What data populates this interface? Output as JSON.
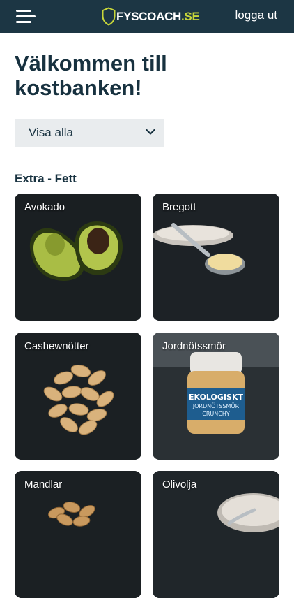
{
  "header": {
    "menu_icon": "hamburger-menu-icon",
    "logo_main": "FYSCOACH",
    "logo_tld": ".SE",
    "logout_label": "logga ut",
    "colors": {
      "bar": "#1c3644",
      "accent": "#c7d63a"
    }
  },
  "main": {
    "title": "Välkommen till kostbanken!",
    "filter": {
      "selected": "Visa alla",
      "icon": "chevron-down-icon"
    },
    "section_title": "Extra - Fett",
    "items": [
      {
        "label": "Avokado"
      },
      {
        "label": "Bregott"
      },
      {
        "label": "Cashewnötter"
      },
      {
        "label": "Jordnötssmör"
      },
      {
        "label": "Mandlar"
      },
      {
        "label": "Olivolja"
      }
    ],
    "jar_label_line1": "EKOLOGISKT",
    "jar_label_line2": "JORDNÖTSSMÖR",
    "jar_label_line3": "CRUNCHY"
  }
}
